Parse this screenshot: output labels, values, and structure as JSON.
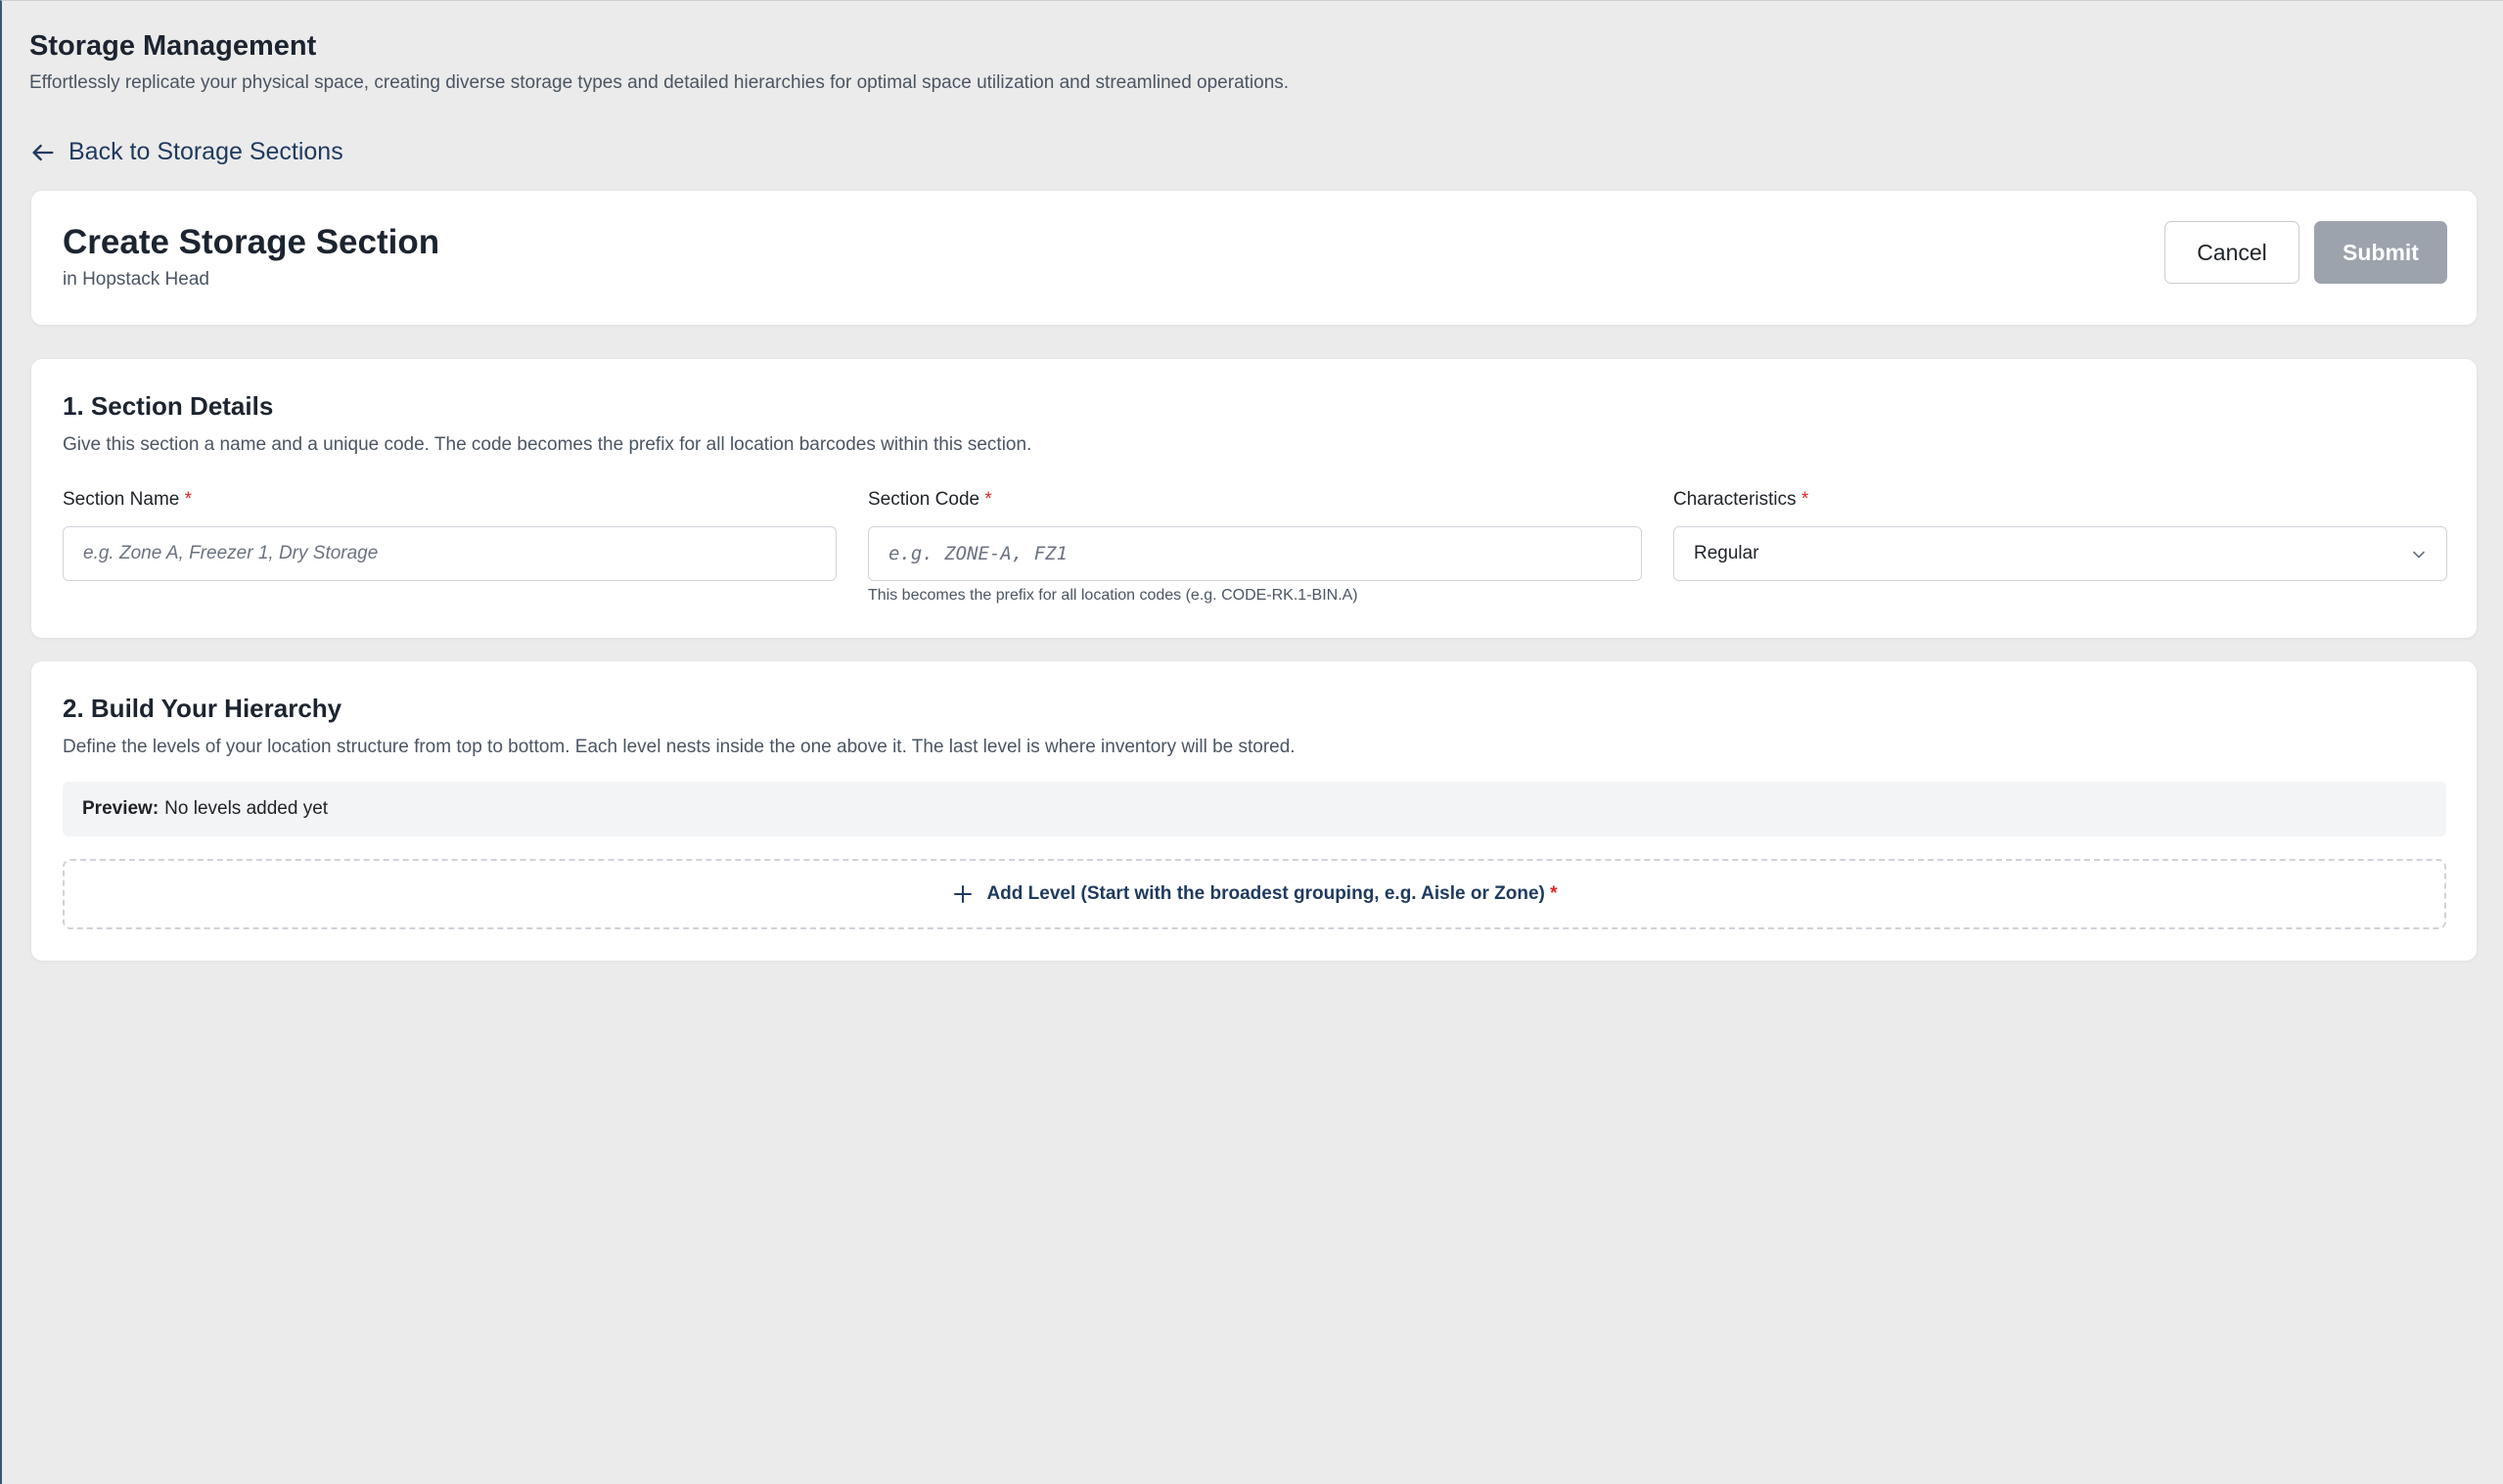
{
  "header": {
    "title": "Storage Management",
    "subtitle": "Effortlessly replicate your physical space, creating diverse storage types and detailed hierarchies for optimal space utilization and streamlined operations."
  },
  "back_link": {
    "label": "Back to Storage Sections",
    "icon": "arrow-left-icon"
  },
  "form_header": {
    "title": "Create Storage Section",
    "location": "in Hopstack Head",
    "cancel_label": "Cancel",
    "submit_label": "Submit"
  },
  "section_details": {
    "heading": "1. Section Details",
    "description": "Give this section a name and a unique code. The code becomes the prefix for all location barcodes within this section.",
    "name": {
      "label": "Section Name",
      "required_mark": "*",
      "placeholder": "e.g. Zone A, Freezer 1, Dry Storage",
      "value": ""
    },
    "code": {
      "label": "Section Code",
      "required_mark": "*",
      "placeholder": "e.g. ZONE-A, FZ1",
      "value": "",
      "hint": "This becomes the prefix for all location codes (e.g. CODE-RK.1-BIN.A)"
    },
    "characteristics": {
      "label": "Characteristics",
      "required_mark": "*",
      "selected": "Regular",
      "icon": "chevron-down-icon"
    }
  },
  "hierarchy": {
    "heading": "2. Build Your Hierarchy",
    "description": "Define the levels of your location structure from top to bottom. Each level nests inside the one above it. The last level is where inventory will be stored.",
    "preview_label": "Preview:",
    "preview_value": "No levels added yet",
    "add_level_label": "Add Level (Start with the broadest grouping, e.g. Aisle or Zone)",
    "add_level_required_mark": "*",
    "add_icon": "plus-icon"
  },
  "colors": {
    "background": "#ebebeb",
    "link": "#1e3a5f",
    "required": "#dc2626",
    "submit_disabled": "#9ca3ad"
  }
}
